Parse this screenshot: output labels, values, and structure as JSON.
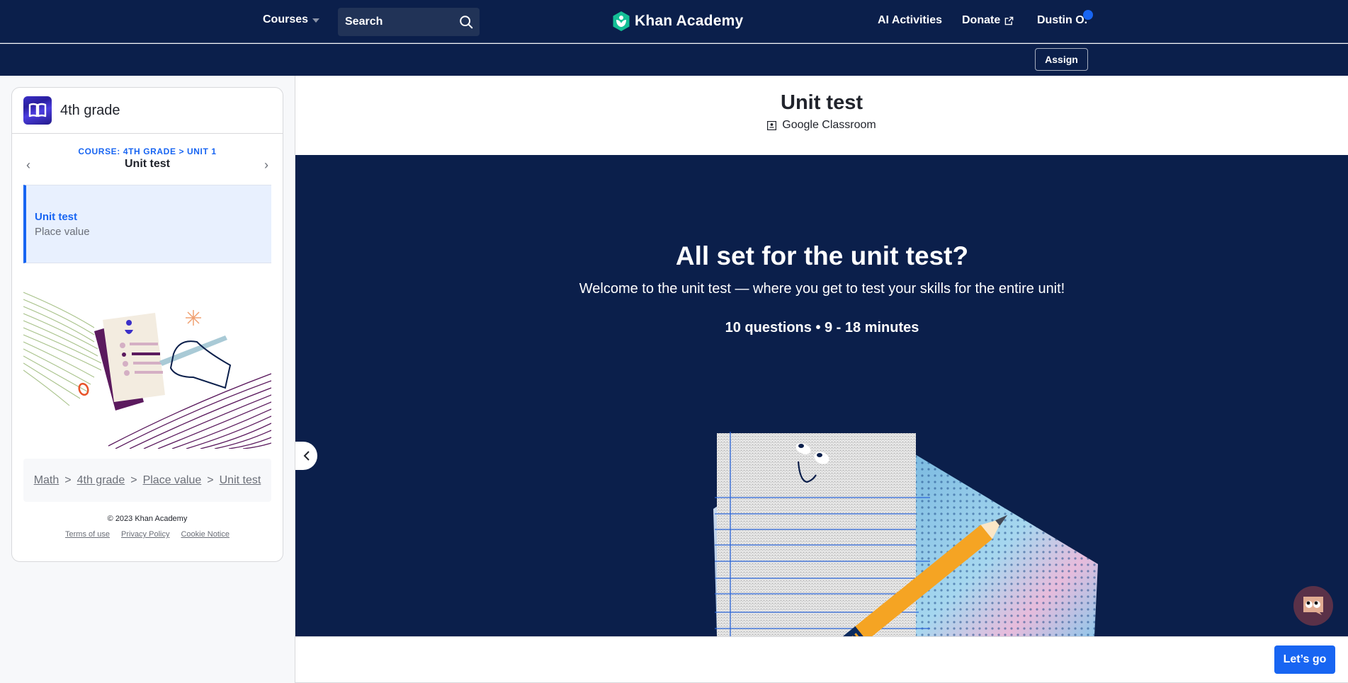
{
  "topnav": {
    "courses_label": "Courses",
    "search_placeholder": "Search",
    "brand": "Khan Academy",
    "ai_activities": "AI Activities",
    "donate": "Donate",
    "user": "Dustin O.",
    "assign": "Assign"
  },
  "sidebar": {
    "course_title": "4th grade",
    "unit_crumb": "COURSE: 4TH GRADE > UNIT 1",
    "unit_name": "Unit test",
    "prev_icon": "chevron-left-icon",
    "next_icon": "chevron-right-icon",
    "active_item": {
      "title": "Unit test",
      "subtitle": "Place value"
    },
    "breadcrumb": [
      "Math",
      "4th grade",
      "Place value",
      "Unit test"
    ],
    "breadcrumb_sep": ">",
    "copyright": "© 2023 Khan Academy",
    "footer_links": [
      "Terms of use",
      "Privacy Policy",
      "Cookie Notice"
    ]
  },
  "main": {
    "title": "Unit test",
    "google_classroom": "Google Classroom",
    "hero_title": "All set for the unit test?",
    "hero_subtitle": "Welcome to the unit test — where you get to test your skills for the entire unit!",
    "hero_meta": "10 questions • 9 - 18 minutes",
    "start_button": "Let’s go"
  },
  "colors": {
    "nav_bg": "#0b1f4b",
    "accent": "#1865f2",
    "active_bg": "#e8f0fe"
  }
}
